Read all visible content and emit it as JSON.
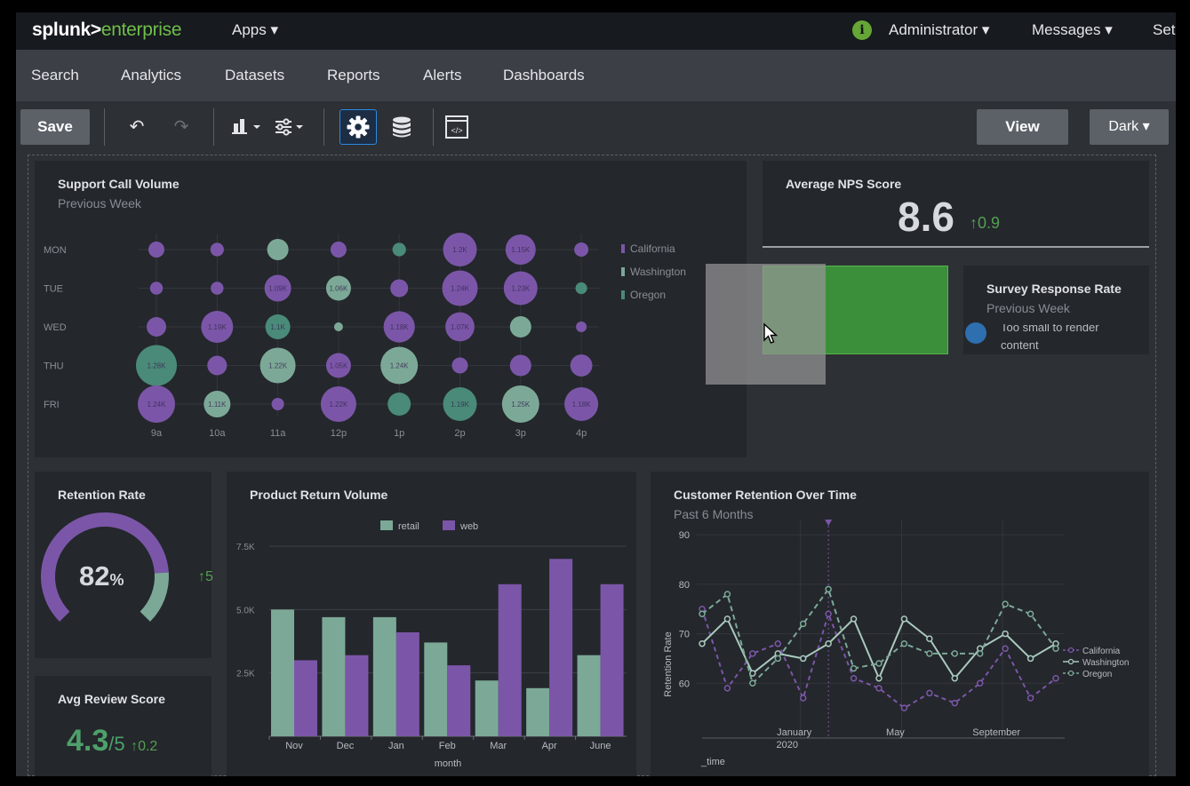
{
  "topbar": {
    "logo_main": "splunk>",
    "logo_suffix": "enterprise",
    "apps": "Apps ▾",
    "admin": "Administrator ▾",
    "messages": "Messages ▾",
    "settings": "Set"
  },
  "nav": {
    "items": [
      "Search",
      "Analytics",
      "Datasets",
      "Reports",
      "Alerts",
      "Dashboards"
    ]
  },
  "toolbar": {
    "save": "Save",
    "view": "View",
    "theme": "Dark ▾"
  },
  "panels": {
    "support": {
      "title": "Support Call Volume",
      "subtitle": "Previous Week",
      "legend": [
        "California",
        "Washington",
        "Oregon"
      ]
    },
    "nps": {
      "title": "Average NPS Score",
      "value": "8.6",
      "delta": "↑0.9"
    },
    "survey": {
      "title": "Survey Response Rate",
      "subtitle": "Previous Week",
      "message": "Too small to render content"
    },
    "retention_rate": {
      "title": "Retention Rate",
      "value": "82",
      "unit": "%",
      "delta": "↑5",
      "fraction": 0.82
    },
    "review": {
      "title": "Avg Review Score",
      "value": "4.3",
      "unit": "/5",
      "delta": "↑0.2"
    },
    "returns": {
      "title": "Product Return Volume"
    },
    "retention_time": {
      "title": "Customer Retention Over Time",
      "subtitle": "Past 6 Months"
    }
  },
  "colors": {
    "california": "#7b56a8",
    "washington": "#7ca997",
    "oregon": "#4a8a78",
    "accent_green": "#3f8f3a",
    "positive": "#53a051"
  },
  "chart_data": [
    {
      "type": "scatter",
      "title": "Support Call Volume",
      "subtitle": "Previous Week",
      "x": [
        "9a",
        "10a",
        "11a",
        "12p",
        "1p",
        "2p",
        "3p",
        "4p"
      ],
      "y": [
        "MON",
        "TUE",
        "WED",
        "THU",
        "FRI"
      ],
      "legend": [
        "California",
        "Washington",
        "Oregon"
      ],
      "bubbles": [
        {
          "x": "9a",
          "y": "MON",
          "series": "California",
          "r": 0.45
        },
        {
          "x": "10a",
          "y": "MON",
          "series": "California",
          "r": 0.38
        },
        {
          "x": "11a",
          "y": "MON",
          "series": "Washington",
          "r": 0.6
        },
        {
          "x": "12p",
          "y": "MON",
          "series": "California",
          "r": 0.45
        },
        {
          "x": "1p",
          "y": "MON",
          "series": "Oregon",
          "r": 0.38
        },
        {
          "x": "2p",
          "y": "MON",
          "series": "California",
          "r": 0.95,
          "label": "1.2K"
        },
        {
          "x": "3p",
          "y": "MON",
          "series": "California",
          "r": 0.85,
          "label": "1.15K"
        },
        {
          "x": "4p",
          "y": "MON",
          "series": "California",
          "r": 0.4
        },
        {
          "x": "9a",
          "y": "TUE",
          "series": "California",
          "r": 0.36
        },
        {
          "x": "10a",
          "y": "TUE",
          "series": "California",
          "r": 0.36
        },
        {
          "x": "11a",
          "y": "TUE",
          "series": "California",
          "r": 0.75,
          "label": "1.09K"
        },
        {
          "x": "12p",
          "y": "TUE",
          "series": "Washington",
          "r": 0.7,
          "label": "1.06K"
        },
        {
          "x": "1p",
          "y": "TUE",
          "series": "California",
          "r": 0.5
        },
        {
          "x": "2p",
          "y": "TUE",
          "series": "California",
          "r": 1.0,
          "label": "1.24K"
        },
        {
          "x": "3p",
          "y": "TUE",
          "series": "California",
          "r": 0.95,
          "label": "1.23K"
        },
        {
          "x": "4p",
          "y": "TUE",
          "series": "Oregon",
          "r": 0.33
        },
        {
          "x": "9a",
          "y": "WED",
          "series": "California",
          "r": 0.55
        },
        {
          "x": "10a",
          "y": "WED",
          "series": "California",
          "r": 0.9,
          "label": "1.19K"
        },
        {
          "x": "11a",
          "y": "WED",
          "series": "Oregon",
          "r": 0.7,
          "label": "1.1K"
        },
        {
          "x": "12p",
          "y": "WED",
          "series": "Washington",
          "r": 0.25
        },
        {
          "x": "1p",
          "y": "WED",
          "series": "California",
          "r": 0.88,
          "label": "1.18K"
        },
        {
          "x": "2p",
          "y": "WED",
          "series": "California",
          "r": 0.82,
          "label": "1.07K"
        },
        {
          "x": "3p",
          "y": "WED",
          "series": "Washington",
          "r": 0.6
        },
        {
          "x": "4p",
          "y": "WED",
          "series": "California",
          "r": 0.3
        },
        {
          "x": "9a",
          "y": "THU",
          "series": "Oregon",
          "r": 1.15,
          "label": "1.28K"
        },
        {
          "x": "10a",
          "y": "THU",
          "series": "California",
          "r": 0.55
        },
        {
          "x": "11a",
          "y": "THU",
          "series": "Washington",
          "r": 1.0,
          "label": "1.22K"
        },
        {
          "x": "12p",
          "y": "THU",
          "series": "California",
          "r": 0.7,
          "label": "1.05K"
        },
        {
          "x": "1p",
          "y": "THU",
          "series": "Washington",
          "r": 1.05,
          "label": "1.24K"
        },
        {
          "x": "2p",
          "y": "THU",
          "series": "California",
          "r": 0.45
        },
        {
          "x": "3p",
          "y": "THU",
          "series": "California",
          "r": 0.6
        },
        {
          "x": "4p",
          "y": "THU",
          "series": "California",
          "r": 0.62
        },
        {
          "x": "9a",
          "y": "FRI",
          "series": "California",
          "r": 1.05,
          "label": "1.24K"
        },
        {
          "x": "10a",
          "y": "FRI",
          "series": "Washington",
          "r": 0.75,
          "label": "1.11K"
        },
        {
          "x": "11a",
          "y": "FRI",
          "series": "California",
          "r": 0.35
        },
        {
          "x": "12p",
          "y": "FRI",
          "series": "California",
          "r": 1.0,
          "label": "1.22K"
        },
        {
          "x": "1p",
          "y": "FRI",
          "series": "Oregon",
          "r": 0.65
        },
        {
          "x": "2p",
          "y": "FRI",
          "series": "Oregon",
          "r": 0.95,
          "label": "1.19K"
        },
        {
          "x": "3p",
          "y": "FRI",
          "series": "Washington",
          "r": 1.05,
          "label": "1.25K"
        },
        {
          "x": "4p",
          "y": "FRI",
          "series": "California",
          "r": 0.95,
          "label": "1.18K"
        }
      ]
    },
    {
      "type": "bar",
      "title": "Product Return Volume",
      "categories": [
        "Nov",
        "Dec",
        "Jan",
        "Feb",
        "Mar",
        "Apr",
        "June"
      ],
      "series": [
        {
          "name": "retail",
          "values": [
            5000,
            4700,
            4700,
            3700,
            2200,
            1900,
            3200
          ]
        },
        {
          "name": "web",
          "values": [
            3000,
            3200,
            4100,
            2800,
            6000,
            7000,
            6000
          ]
        }
      ],
      "xlabel": "month",
      "ylim": [
        0,
        7500
      ],
      "yticks": [
        "2.5K",
        "5.0K",
        "7.5K"
      ],
      "legend": [
        "retail",
        "web"
      ]
    },
    {
      "type": "line",
      "title": "Customer Retention Over Time",
      "subtitle": "Past 6 Months",
      "xlabel": "_time",
      "ylabel": "Retention Rate",
      "ylim": [
        50,
        92
      ],
      "yticks": [
        60,
        70,
        80,
        90
      ],
      "xticks": [
        {
          "label": "January",
          "sub": "2020",
          "i": 4
        },
        {
          "label": "May",
          "i": 8
        },
        {
          "label": "September",
          "i": 12
        }
      ],
      "series": [
        {
          "name": "California",
          "values": [
            75,
            59,
            66,
            68,
            57,
            74,
            61,
            59,
            55,
            58,
            56,
            60,
            67,
            57,
            61
          ]
        },
        {
          "name": "Washington",
          "values": [
            68,
            73,
            62,
            66,
            65,
            68,
            73,
            61,
            73,
            69,
            61,
            67,
            70,
            65,
            68
          ]
        },
        {
          "name": "Oregon",
          "values": [
            74,
            78,
            60,
            65,
            72,
            79,
            63,
            64,
            68,
            66,
            66,
            66,
            76,
            74,
            67
          ]
        }
      ]
    }
  ]
}
